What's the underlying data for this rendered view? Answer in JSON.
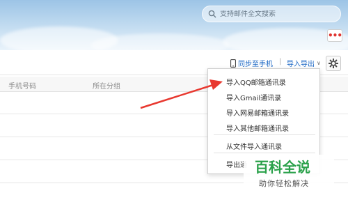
{
  "search": {
    "placeholder": "支持邮件全文搜索"
  },
  "toolbar": {
    "sync_label": "同步至手机",
    "separator": "|",
    "import_export_label": "导入导出",
    "chevron": "∨"
  },
  "table": {
    "columns": [
      "手机号码",
      "所在分组"
    ]
  },
  "menu": {
    "items": [
      "导入QQ邮箱通讯录",
      "导入Gmail通讯录",
      "导入网易邮箱通讯录",
      "导入其他邮箱通讯录",
      "从文件导入通讯录",
      "导出通"
    ]
  },
  "watermark": {
    "logo_text": "百科全说",
    "subtitle": "助你轻松解决"
  },
  "colors": {
    "link": "#1a66c4",
    "arrow": "#e8382f",
    "more_dots": "#e0342f",
    "watermark_green": "#2aa14a"
  },
  "icons": [
    "search-icon",
    "more-icon",
    "phone-icon",
    "chevron-down-icon",
    "gear-icon",
    "arrow-annotation"
  ]
}
